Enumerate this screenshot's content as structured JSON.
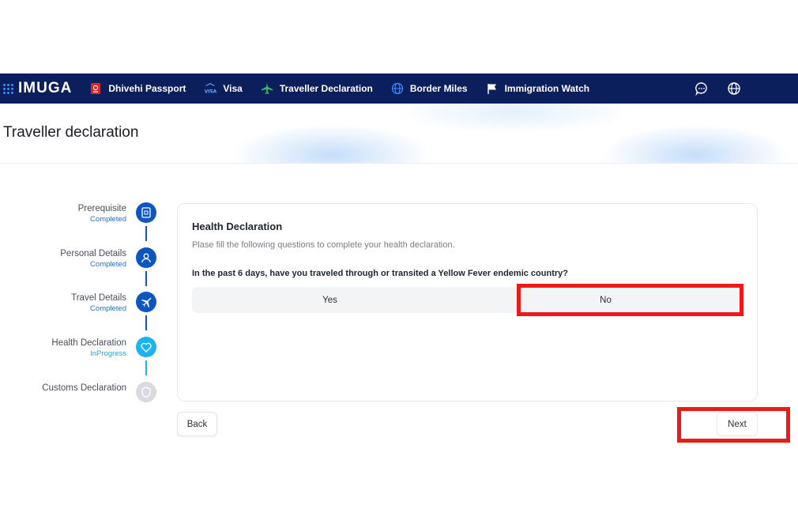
{
  "app": {
    "logo_text": "IMUGA"
  },
  "nav": {
    "items": [
      {
        "label": "Dhivehi Passport",
        "icon": "passport-icon"
      },
      {
        "label": "Visa",
        "icon": "visa-icon"
      },
      {
        "label": "Traveller Declaration",
        "icon": "airplane-icon"
      },
      {
        "label": "Border Miles",
        "icon": "globe-icon"
      },
      {
        "label": "Immigration Watch",
        "icon": "flag-icon"
      }
    ],
    "right_icons": [
      "chat-icon",
      "language-globe-icon"
    ]
  },
  "page": {
    "title": "Traveller declaration"
  },
  "stepper": {
    "steps": [
      {
        "title": "Prerequisite",
        "status": "Completed",
        "icon": "document-icon"
      },
      {
        "title": "Personal Details",
        "status": "Completed",
        "icon": "user-icon"
      },
      {
        "title": "Travel Details",
        "status": "Completed",
        "icon": "plane-icon"
      },
      {
        "title": "Health Declaration",
        "status": "InProgress",
        "icon": "heart-icon"
      },
      {
        "title": "Customs Declaration",
        "status": "",
        "icon": "shield-icon"
      }
    ]
  },
  "form": {
    "title": "Health Declaration",
    "subtitle": "Plase fill the following questions to complete your health declaration.",
    "question": "In the past 6 days, have you traveled through or transited a Yellow Fever endemic country?",
    "options": [
      "Yes",
      "No"
    ]
  },
  "actions": {
    "back_label": "Back",
    "next_label": "Next"
  },
  "colors": {
    "navbar": "#0b1f5c",
    "step_done": "#0d56c2",
    "step_active": "#1eb3f0",
    "highlight": "#ee1a1a"
  }
}
